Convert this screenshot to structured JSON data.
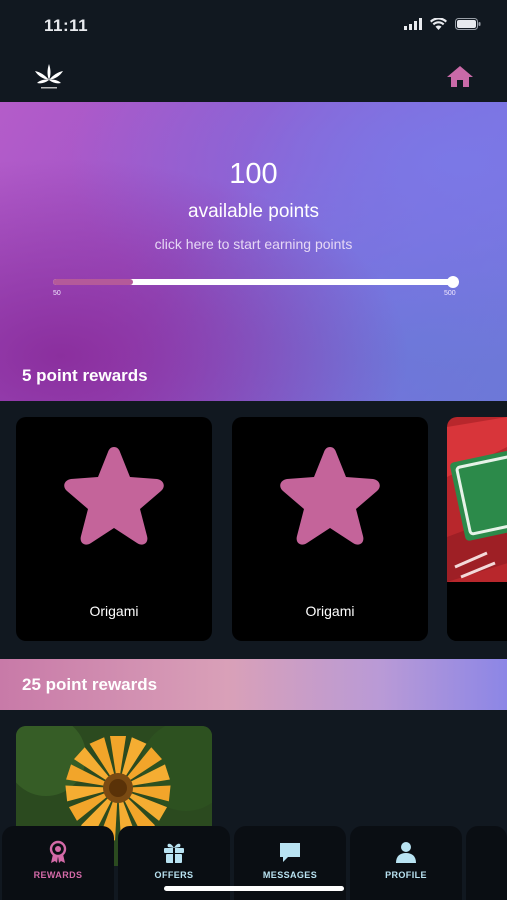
{
  "status_bar": {
    "time": "11:11"
  },
  "header": {
    "logo_icon": "cannabis-leaf-logo",
    "home_icon": "home-icon"
  },
  "hero": {
    "points": "100",
    "points_label": "available points",
    "earn_link": "click here to start earning points",
    "progress": {
      "min_label": "50",
      "max_label": "500",
      "fill_fraction": 0.2
    }
  },
  "sections": [
    {
      "title": "5 point rewards",
      "cards": [
        {
          "label": "Origami",
          "icon": "star-icon"
        },
        {
          "label": "Origami",
          "icon": "star-icon"
        },
        {
          "label": "",
          "icon": "money-card-image"
        }
      ]
    },
    {
      "title": "25 point rewards",
      "cards": [
        {
          "label": "",
          "icon": "orange-flower-image"
        }
      ]
    }
  ],
  "tabs": [
    {
      "label": "REWARDS",
      "icon": "award-ribbon-icon",
      "active": true
    },
    {
      "label": "OFFERS",
      "icon": "gift-icon",
      "active": false
    },
    {
      "label": "MESSAGES",
      "icon": "chat-bubble-icon",
      "active": false
    },
    {
      "label": "PROFILE",
      "icon": "user-icon",
      "active": false
    }
  ],
  "colors": {
    "accent": "#b45a9a",
    "tab_active": "#d46aa8",
    "tab_inactive": "#b9e3f2",
    "background": "#111820"
  }
}
